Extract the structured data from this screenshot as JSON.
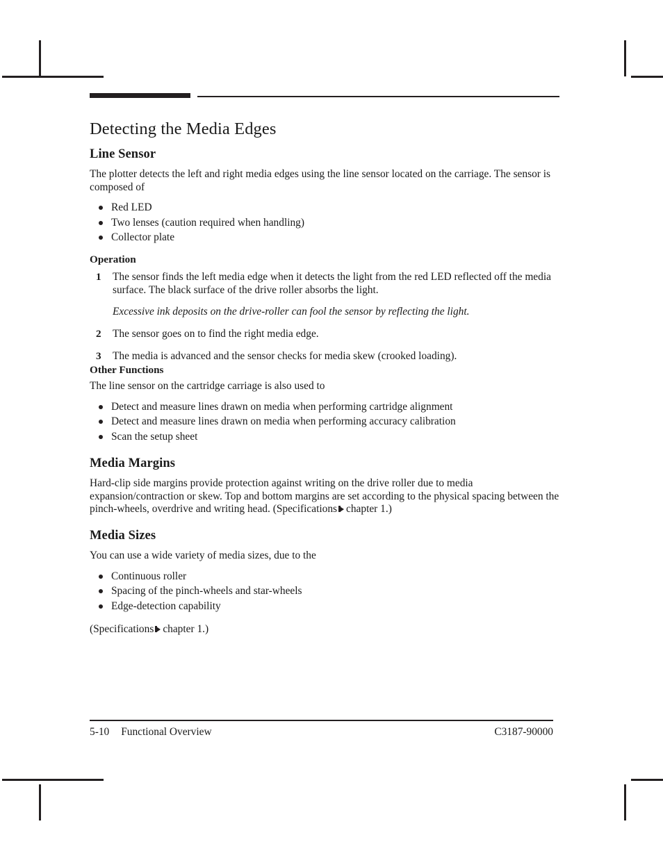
{
  "document": {
    "title": "Detecting the Media Edges"
  },
  "sections": {
    "line_sensor": {
      "heading": "Line Sensor",
      "intro": "The plotter detects the left and right media edges using the line sensor located on the carriage.  The sensor is composed of",
      "components": [
        "Red LED",
        "Two lenses (caution required when handling)",
        "Collector plate"
      ],
      "operation": {
        "heading": "Operation",
        "steps": [
          {
            "number": "1",
            "text": "The sensor finds the left media edge when it detects the light from the red LED reflected off the media surface.  The black surface of the drive roller absorbs the light."
          },
          {
            "number": "2",
            "text": "The sensor goes on to find the right media edge."
          },
          {
            "number": "3",
            "text": "The media is advanced and the sensor checks for media skew (crooked loading)."
          }
        ],
        "note": "Excessive ink deposits on the drive-roller can fool the sensor by reflecting the light."
      },
      "other_functions": {
        "heading": "Other Functions",
        "intro": "The line sensor on the cartridge carriage is also used to",
        "items": [
          "Detect and measure lines drawn on media when performing cartridge alignment",
          "Detect and measure lines drawn on media when performing accuracy calibration",
          "Scan the setup sheet"
        ]
      }
    },
    "media_margins": {
      "heading": "Media Margins",
      "body_before_xref": "Hard-clip side margins provide protection against writing on the drive roller due to media expansion/contraction or skew.  Top and bottom margins are set according to the physical spacing between the pinch-wheels, overdrive and writing head.  (Specifications",
      "body_after_xref": "chapter 1.)"
    },
    "media_sizes": {
      "heading": "Media Sizes",
      "intro": "You can use a wide variety of media sizes, due to the",
      "items": [
        "Continuous roller",
        "Spacing of the pinch-wheels and star-wheels",
        "Edge-detection capability"
      ],
      "xref_before": "(Specifications",
      "xref_after": "chapter 1.)"
    }
  },
  "footer": {
    "page_number": "5-10",
    "chapter_title": "Functional Overview",
    "part_number": "C3187-90000"
  }
}
